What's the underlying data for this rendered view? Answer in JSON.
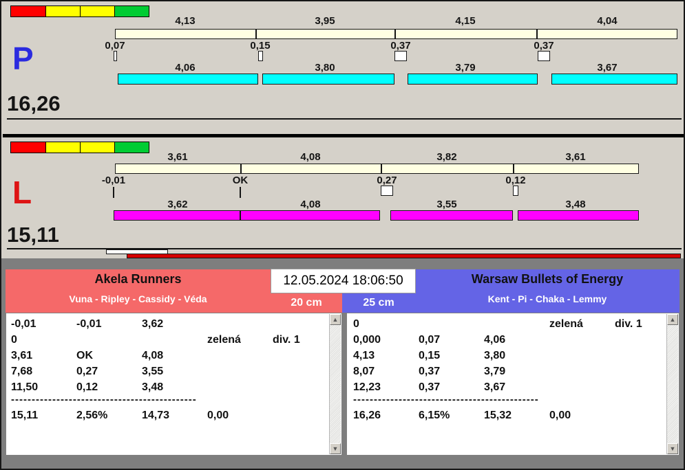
{
  "header": {
    "date_time": "12.05.2024 18:06:50"
  },
  "icons": {
    "scroll_up": "▲",
    "scroll_down": "▼"
  },
  "colors": {
    "panel_bg": "#D5D1C9",
    "bottom_bg": "#7E7E7E",
    "split_bar": "#FFFFE2",
    "lane_p_bar": "#00FFFF",
    "lane_l_bar": "#FF00FF",
    "lane_p_letter": "#2B2BDF",
    "lane_l_letter": "#DE1414",
    "team_left_bg": "#F56969",
    "team_right_bg": "#6464E6",
    "indicator": [
      "#FF0000",
      "#FFFF00",
      "#FFFF00",
      "#00CC33"
    ],
    "progress_red": "#D40000"
  },
  "lanes": [
    {
      "letter": "P",
      "total": "16,26",
      "segments": [
        {
          "split": "4,13",
          "leg": "4,06"
        },
        {
          "split": "3,95",
          "leg": "3,80"
        },
        {
          "split": "4,15",
          "leg": "3,79"
        },
        {
          "split": "4,04",
          "leg": "3,67"
        }
      ],
      "exchanges": [
        "0,07",
        "0,15",
        "0,37",
        "0,37"
      ]
    },
    {
      "letter": "L",
      "total": "15,11",
      "segments": [
        {
          "split": "3,61",
          "leg": "3,62"
        },
        {
          "split": "4,08",
          "leg": "4,08"
        },
        {
          "split": "3,82",
          "leg": "3,55"
        },
        {
          "split": "3,61",
          "leg": "3,48"
        }
      ],
      "exchanges": [
        "-0,01",
        "OK",
        "0,27",
        "0,12"
      ]
    }
  ],
  "teams": {
    "left": {
      "name": "Akela Runners",
      "runners": "Vuna - Ripley - Cassidy - Véda",
      "distance": "20 cm"
    },
    "right": {
      "name": "Warsaw Bullets of Energy",
      "runners": "Kent - Pi - Chaka - Lemmy",
      "distance": "25 cm"
    }
  },
  "tables": {
    "left": {
      "rows": [
        [
          "-0,01",
          "-0,01",
          "3,62",
          "",
          ""
        ],
        [
          "0",
          "",
          "",
          "zelená",
          "div. 1"
        ],
        [
          "3,61",
          "OK",
          "4,08",
          "",
          ""
        ],
        [
          "7,68",
          "0,27",
          "3,55",
          "",
          ""
        ],
        [
          "11,50",
          "0,12",
          "3,48",
          "",
          ""
        ]
      ],
      "separator": "---------------------------------------------",
      "totals": [
        "15,11",
        "2,56%",
        "14,73",
        "0,00"
      ]
    },
    "right": {
      "rows": [
        [
          "0",
          "",
          "",
          "zelená",
          "div. 1"
        ],
        [
          "0,000",
          "0,07",
          "4,06",
          "",
          ""
        ],
        [
          "4,13",
          "0,15",
          "3,80",
          "",
          ""
        ],
        [
          "8,07",
          "0,37",
          "3,79",
          "",
          ""
        ],
        [
          "12,23",
          "0,37",
          "3,67",
          "",
          ""
        ]
      ],
      "separator": "---------------------------------------------",
      "totals": [
        "16,26",
        "6,15%",
        "15,32",
        "0,00"
      ]
    }
  }
}
